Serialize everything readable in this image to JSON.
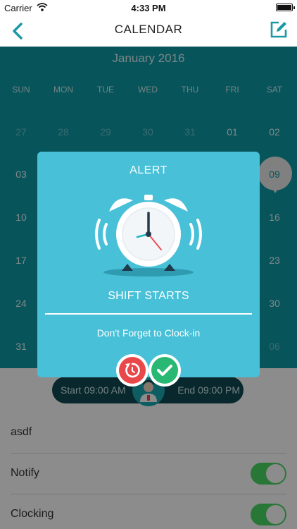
{
  "status_bar": {
    "carrier": "Carrier",
    "time": "4:33 PM"
  },
  "nav": {
    "title": "CALENDAR",
    "back_icon": "chevron-left-icon",
    "edit_icon": "edit-icon"
  },
  "calendar": {
    "month": "January 2016",
    "weekdays": [
      "SUN",
      "MON",
      "TUE",
      "WED",
      "THU",
      "FRI",
      "SAT"
    ],
    "weeks": [
      [
        "27",
        "28",
        "29",
        "30",
        "31",
        "01",
        "02"
      ],
      [
        "03",
        "",
        "",
        "",
        "",
        "",
        "09"
      ],
      [
        "10",
        "",
        "",
        "",
        "",
        "",
        "16"
      ],
      [
        "17",
        "",
        "",
        "",
        "",
        "",
        "23"
      ],
      [
        "24",
        "",
        "",
        "",
        "",
        "",
        "30"
      ],
      [
        "31",
        "",
        "",
        "",
        "",
        "",
        "06"
      ]
    ],
    "muted_days": [
      "27",
      "28",
      "29",
      "30",
      "31",
      "06"
    ],
    "selected_day": "09"
  },
  "shift": {
    "start": "Start 09:00 AM",
    "end": "End 09:00 PM"
  },
  "rows": [
    {
      "label": "asdf",
      "toggle": false
    },
    {
      "label": "Notify",
      "toggle": true
    },
    {
      "label": "Clocking",
      "toggle": true
    }
  ],
  "alert": {
    "title": "ALERT",
    "heading": "SHIFT STARTS",
    "message": "Don't Forget to Clock-in",
    "icon": "alarm-clock-icon"
  },
  "actions": {
    "retry_icon": "snooze-icon",
    "confirm_icon": "checkmark-icon"
  },
  "colors": {
    "teal": "#0d9aa6",
    "alert_bg": "#48c0d8",
    "toggle_on": "#4cd964",
    "retry_red": "#e8484a",
    "confirm_green": "#29b873"
  }
}
